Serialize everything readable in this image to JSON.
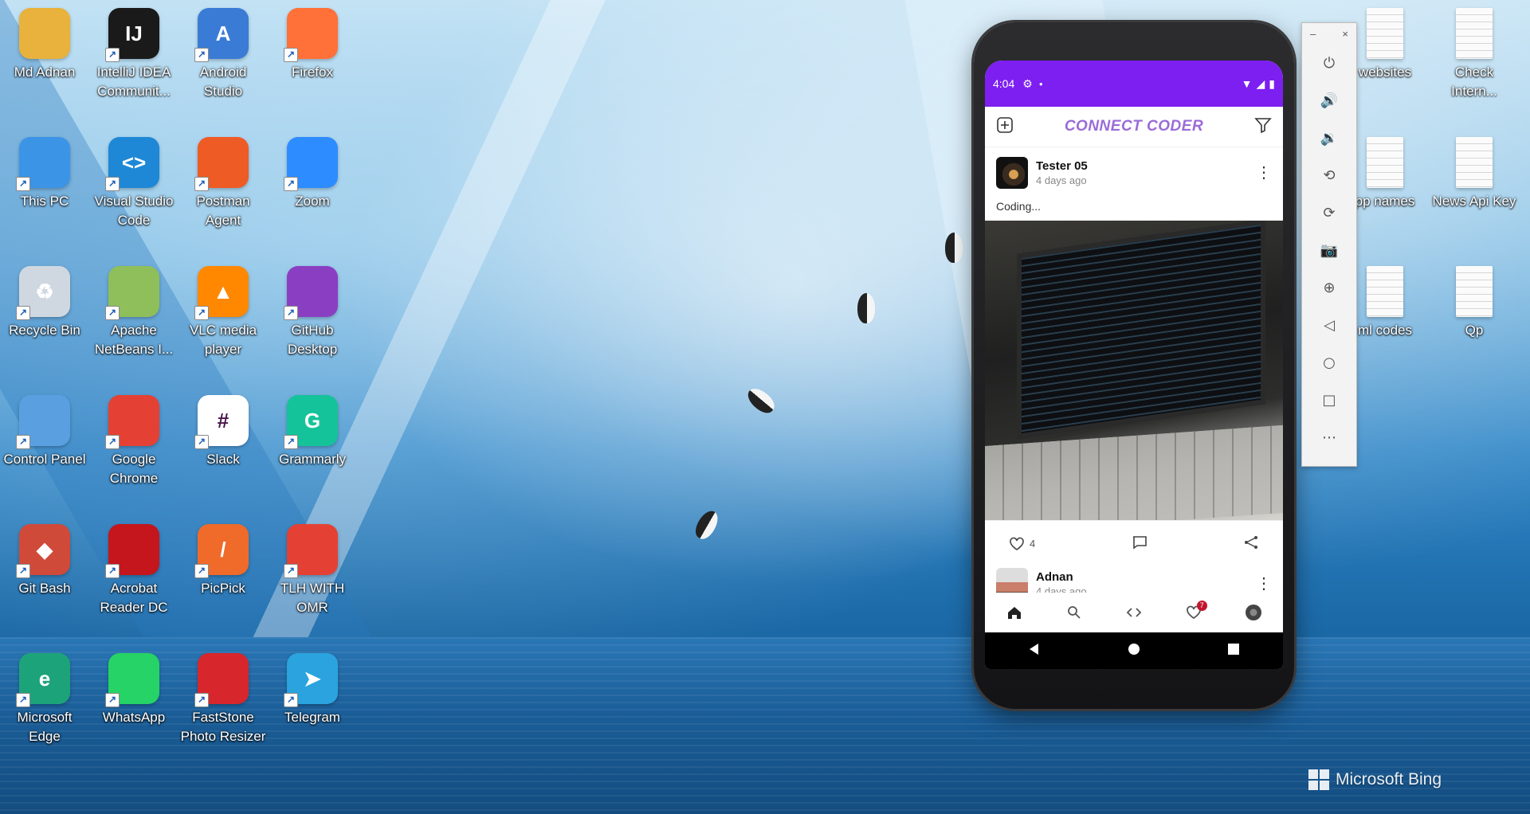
{
  "desktop": {
    "icons_left": [
      {
        "label": "Md Adnan",
        "icon": "user-folder-icon",
        "color": "#e8b23c",
        "glyph": ""
      },
      {
        "label": "IntelliJ IDEA\nCommunit...",
        "icon": "intellij-icon",
        "color": "#1a1a1a",
        "glyph": "IJ"
      },
      {
        "label": "Android\nStudio",
        "icon": "android-studio-icon",
        "color": "#3a7bd5",
        "glyph": "A"
      },
      {
        "label": "Firefox",
        "icon": "firefox-icon",
        "color": "#ff7139",
        "glyph": ""
      },
      {
        "label": "This PC",
        "icon": "computer-icon",
        "color": "#3c94e6",
        "glyph": ""
      },
      {
        "label": "Visual Studio\nCode",
        "icon": "vscode-icon",
        "color": "#1e88d6",
        "glyph": "<>"
      },
      {
        "label": "Postman\nAgent",
        "icon": "postman-icon",
        "color": "#ef5b25",
        "glyph": ""
      },
      {
        "label": "Zoom",
        "icon": "zoom-icon",
        "color": "#2d8cff",
        "glyph": ""
      },
      {
        "label": "Recycle Bin",
        "icon": "recycle-bin-icon",
        "color": "#cfd8e0",
        "glyph": "♻"
      },
      {
        "label": "Apache\nNetBeans I...",
        "icon": "netbeans-icon",
        "color": "#8fbf5a",
        "glyph": ""
      },
      {
        "label": "VLC media\nplayer",
        "icon": "vlc-icon",
        "color": "#ff8800",
        "glyph": "▲"
      },
      {
        "label": "GitHub\nDesktop",
        "icon": "github-icon",
        "color": "#8a3fc2",
        "glyph": ""
      },
      {
        "label": "Control Panel",
        "icon": "control-panel-icon",
        "color": "#5aa0e0",
        "glyph": ""
      },
      {
        "label": "Google\nChrome",
        "icon": "chrome-icon",
        "color": "#e44134",
        "glyph": ""
      },
      {
        "label": "Slack",
        "icon": "slack-icon",
        "color": "#ffffff",
        "glyph": "#"
      },
      {
        "label": "Grammarly",
        "icon": "grammarly-icon",
        "color": "#15c39a",
        "glyph": "G"
      },
      {
        "label": "Git Bash",
        "icon": "git-bash-icon",
        "color": "#d04a3a",
        "glyph": "◆"
      },
      {
        "label": "Acrobat\nReader DC",
        "icon": "acrobat-icon",
        "color": "#c4161c",
        "glyph": ""
      },
      {
        "label": "PicPick",
        "icon": "picpick-icon",
        "color": "#f06a2a",
        "glyph": "/"
      },
      {
        "label": "TLH WITH\nOMR",
        "icon": "chrome-profile-icon",
        "color": "#e44134",
        "glyph": ""
      },
      {
        "label": "Microsoft\nEdge",
        "icon": "edge-icon",
        "color": "#1da37a",
        "glyph": "e"
      },
      {
        "label": "WhatsApp",
        "icon": "whatsapp-icon",
        "color": "#25d366",
        "glyph": ""
      },
      {
        "label": "FastStone\nPhoto Resizer",
        "icon": "faststone-icon",
        "color": "#d8262d",
        "glyph": ""
      },
      {
        "label": "Telegram",
        "icon": "telegram-icon",
        "color": "#2aa3de",
        "glyph": "➤"
      }
    ],
    "icons_right": [
      {
        "label": "websites",
        "icon": "file-icon"
      },
      {
        "label": "Check\nIntern...",
        "icon": "file-icon"
      },
      {
        "label": "pp names",
        "icon": "file-icon"
      },
      {
        "label": "News Api Key",
        "icon": "file-icon"
      },
      {
        "label": "ml codes",
        "icon": "file-icon"
      },
      {
        "label": "Qp",
        "icon": "file-icon"
      }
    ],
    "watermark": "Microsoft Bing"
  },
  "phone": {
    "status_time": "4:04",
    "app_title": "CONNECT CODER",
    "posts": [
      {
        "name": "Tester 05",
        "time": "4 days ago",
        "text": "Coding...",
        "likes": "4"
      },
      {
        "name": "Adnan",
        "time": "4 days ago"
      }
    ],
    "notification_badge": "7",
    "accent": "#7c1ff0"
  },
  "emulator": {
    "minimize": "–",
    "close": "×",
    "buttons": [
      "power-icon",
      "volume-up-icon",
      "volume-down-icon",
      "rotate-left-icon",
      "rotate-right-icon",
      "camera-icon",
      "zoom-icon",
      "back-icon",
      "home-icon",
      "overview-icon",
      "more-icon"
    ]
  }
}
